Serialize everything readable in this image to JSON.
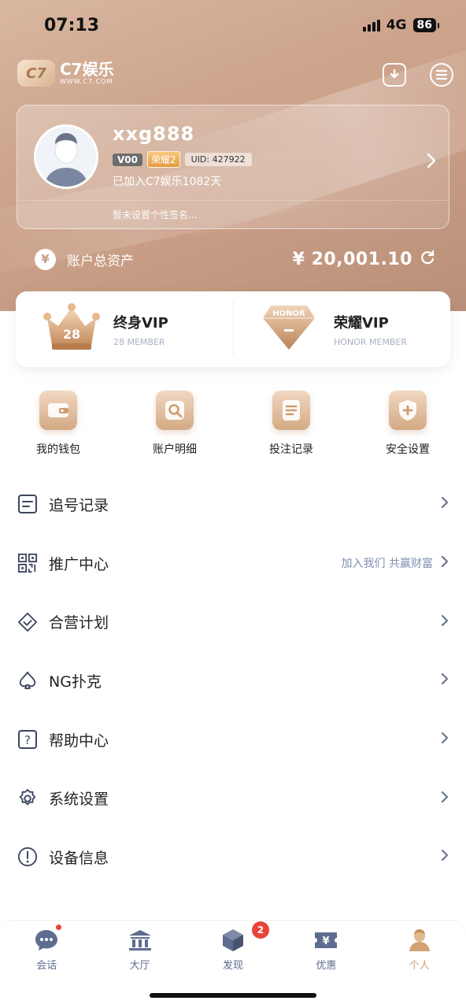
{
  "status_bar": {
    "time": "07:13",
    "network": "4G",
    "battery": "86"
  },
  "brand": {
    "name": "C7娱乐",
    "url": "WWW.C7.COM",
    "mark": "C7"
  },
  "profile": {
    "username": "xxg888",
    "vip_level": "V00",
    "honor_badge": "荣耀2",
    "uid": "UID: 427922",
    "joined": "已加入C7娱乐1082天",
    "signature": "暂未设置个性签名..."
  },
  "assets": {
    "label": "账户总资产",
    "value": "¥ 20,001.10",
    "currency_symbol": "¥"
  },
  "vip": [
    {
      "title": "终身VIP",
      "subtitle": "28 MEMBER",
      "badge": "28"
    },
    {
      "title": "荣耀VIP",
      "subtitle": "HONOR MEMBER",
      "badge": "HONOR"
    }
  ],
  "quick_actions": [
    {
      "label": "我的钱包",
      "icon": "wallet-icon"
    },
    {
      "label": "账户明细",
      "icon": "search-icon"
    },
    {
      "label": "投注记录",
      "icon": "document-icon"
    },
    {
      "label": "安全设置",
      "icon": "shield-icon"
    }
  ],
  "menu": [
    {
      "label": "追号记录",
      "hint": "",
      "icon": "list-icon"
    },
    {
      "label": "推广中心",
      "hint": "加入我们 共赢财富",
      "icon": "qr-code-icon"
    },
    {
      "label": "合营计划",
      "hint": "",
      "icon": "handshake-icon"
    },
    {
      "label": "NG扑克",
      "hint": "",
      "icon": "spade-icon"
    },
    {
      "label": "帮助中心",
      "hint": "",
      "icon": "help-icon"
    },
    {
      "label": "系统设置",
      "hint": "",
      "icon": "gear-icon"
    },
    {
      "label": "设备信息",
      "hint": "",
      "icon": "info-icon"
    }
  ],
  "tabs": [
    {
      "label": "会话",
      "icon": "chat-icon",
      "active": false
    },
    {
      "label": "大厅",
      "icon": "bank-icon",
      "active": false
    },
    {
      "label": "发现",
      "icon": "cube-icon",
      "active": false,
      "badge": "2"
    },
    {
      "label": "优惠",
      "icon": "coupon-icon",
      "active": false
    },
    {
      "label": "个人",
      "icon": "user-icon",
      "active": true
    }
  ],
  "colors": {
    "accent": "#cf9d6f",
    "hero": "#cda58d",
    "tab_inactive": "#5e6d8f",
    "badge_red": "#e8443a"
  }
}
